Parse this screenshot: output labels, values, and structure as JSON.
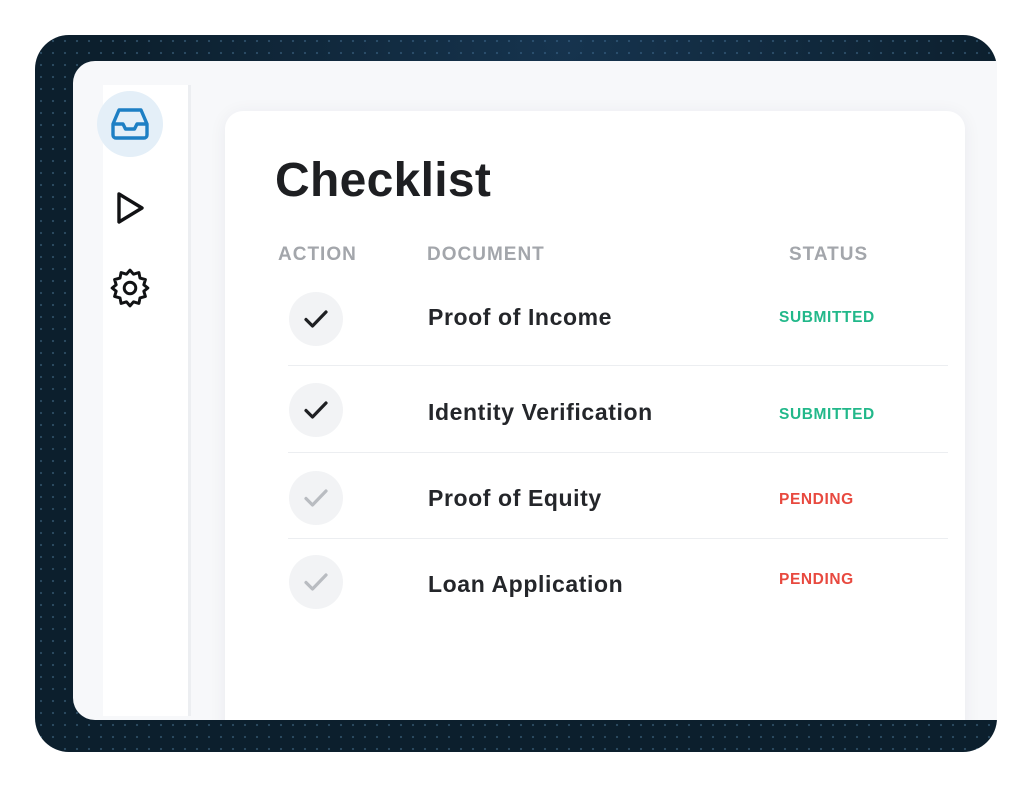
{
  "sidebar": {
    "items": [
      {
        "icon": "inbox-icon",
        "active": true
      },
      {
        "icon": "play-icon",
        "active": false
      },
      {
        "icon": "gear-icon",
        "active": false
      }
    ]
  },
  "checklist": {
    "title": "Checklist",
    "columns": {
      "action": "ACTION",
      "document": "DOCUMENT",
      "status": "STATUS"
    },
    "rows": [
      {
        "document": "Proof of Income",
        "status": "SUBMITTED",
        "checked": true
      },
      {
        "document": "Identity Verification",
        "status": "SUBMITTED",
        "checked": true
      },
      {
        "document": "Proof of Equity",
        "status": "PENDING",
        "checked": false
      },
      {
        "document": "Loan Application",
        "status": "PENDING",
        "checked": false
      }
    ]
  },
  "colors": {
    "accent": "#1d7fc4",
    "submitted": "#22b88a",
    "pending": "#e8493f",
    "check_done": "#1f2023",
    "check_pending": "#b9bcc1"
  }
}
